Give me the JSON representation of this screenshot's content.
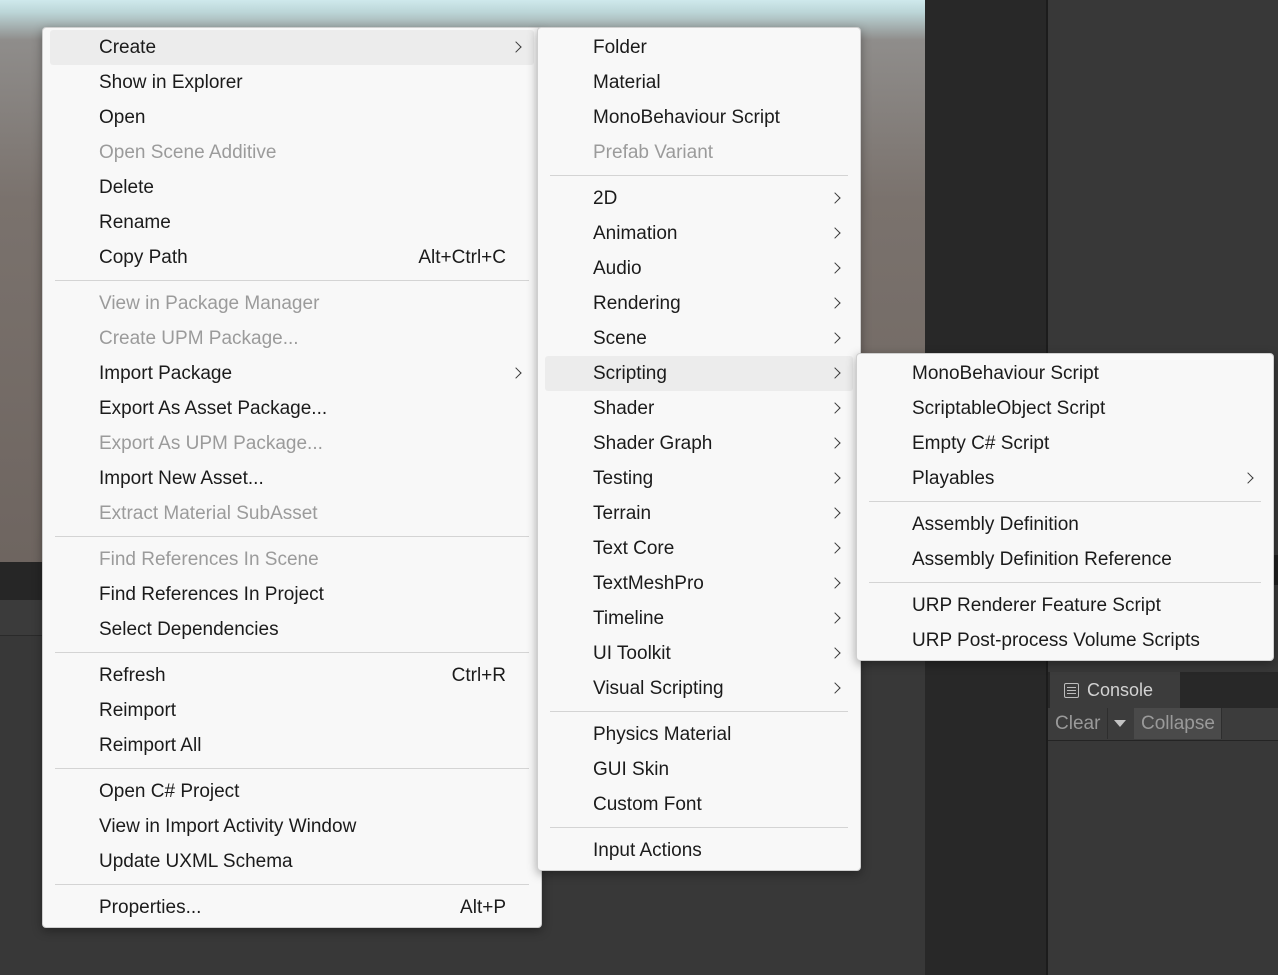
{
  "menus": {
    "main": {
      "groups": [
        [
          {
            "label": "Create",
            "shortcut": "",
            "submenu": true,
            "disabled": false,
            "highlighted": true
          },
          {
            "label": "Show in Explorer",
            "shortcut": "",
            "submenu": false,
            "disabled": false
          },
          {
            "label": "Open",
            "shortcut": "",
            "submenu": false,
            "disabled": false
          },
          {
            "label": "Open Scene Additive",
            "shortcut": "",
            "submenu": false,
            "disabled": true
          },
          {
            "label": "Delete",
            "shortcut": "",
            "submenu": false,
            "disabled": false
          },
          {
            "label": "Rename",
            "shortcut": "",
            "submenu": false,
            "disabled": false
          },
          {
            "label": "Copy Path",
            "shortcut": "Alt+Ctrl+C",
            "submenu": false,
            "disabled": false
          }
        ],
        [
          {
            "label": "View in Package Manager",
            "shortcut": "",
            "submenu": false,
            "disabled": true
          },
          {
            "label": "Create UPM Package...",
            "shortcut": "",
            "submenu": false,
            "disabled": true
          },
          {
            "label": "Import Package",
            "shortcut": "",
            "submenu": true,
            "disabled": false
          },
          {
            "label": "Export As Asset Package...",
            "shortcut": "",
            "submenu": false,
            "disabled": false
          },
          {
            "label": "Export As UPM Package...",
            "shortcut": "",
            "submenu": false,
            "disabled": true
          },
          {
            "label": "Import New Asset...",
            "shortcut": "",
            "submenu": false,
            "disabled": false
          },
          {
            "label": "Extract Material SubAsset",
            "shortcut": "",
            "submenu": false,
            "disabled": true
          }
        ],
        [
          {
            "label": "Find References In Scene",
            "shortcut": "",
            "submenu": false,
            "disabled": true
          },
          {
            "label": "Find References In Project",
            "shortcut": "",
            "submenu": false,
            "disabled": false
          },
          {
            "label": "Select Dependencies",
            "shortcut": "",
            "submenu": false,
            "disabled": false
          }
        ],
        [
          {
            "label": "Refresh",
            "shortcut": "Ctrl+R",
            "submenu": false,
            "disabled": false
          },
          {
            "label": "Reimport",
            "shortcut": "",
            "submenu": false,
            "disabled": false
          },
          {
            "label": "Reimport All",
            "shortcut": "",
            "submenu": false,
            "disabled": false
          }
        ],
        [
          {
            "label": "Open C# Project",
            "shortcut": "",
            "submenu": false,
            "disabled": false
          },
          {
            "label": "View in Import Activity Window",
            "shortcut": "",
            "submenu": false,
            "disabled": false
          },
          {
            "label": "Update UXML Schema",
            "shortcut": "",
            "submenu": false,
            "disabled": false
          }
        ],
        [
          {
            "label": "Properties...",
            "shortcut": "Alt+P",
            "submenu": false,
            "disabled": false
          }
        ]
      ]
    },
    "create": {
      "groups": [
        [
          {
            "label": "Folder",
            "submenu": false,
            "disabled": false
          },
          {
            "label": "Material",
            "submenu": false,
            "disabled": false
          },
          {
            "label": "MonoBehaviour Script",
            "submenu": false,
            "disabled": false
          },
          {
            "label": "Prefab Variant",
            "submenu": false,
            "disabled": true
          }
        ],
        [
          {
            "label": "2D",
            "submenu": true,
            "disabled": false
          },
          {
            "label": "Animation",
            "submenu": true,
            "disabled": false
          },
          {
            "label": "Audio",
            "submenu": true,
            "disabled": false
          },
          {
            "label": "Rendering",
            "submenu": true,
            "disabled": false
          },
          {
            "label": "Scene",
            "submenu": true,
            "disabled": false
          },
          {
            "label": "Scripting",
            "submenu": true,
            "disabled": false,
            "highlighted": true
          },
          {
            "label": "Shader",
            "submenu": true,
            "disabled": false
          },
          {
            "label": "Shader Graph",
            "submenu": true,
            "disabled": false
          },
          {
            "label": "Testing",
            "submenu": true,
            "disabled": false
          },
          {
            "label": "Terrain",
            "submenu": true,
            "disabled": false
          },
          {
            "label": "Text Core",
            "submenu": true,
            "disabled": false
          },
          {
            "label": "TextMeshPro",
            "submenu": true,
            "disabled": false
          },
          {
            "label": "Timeline",
            "submenu": true,
            "disabled": false
          },
          {
            "label": "UI Toolkit",
            "submenu": true,
            "disabled": false
          },
          {
            "label": "Visual Scripting",
            "submenu": true,
            "disabled": false
          }
        ],
        [
          {
            "label": "Physics Material",
            "submenu": false,
            "disabled": false
          },
          {
            "label": "GUI Skin",
            "submenu": false,
            "disabled": false
          },
          {
            "label": "Custom Font",
            "submenu": false,
            "disabled": false
          }
        ],
        [
          {
            "label": "Input Actions",
            "submenu": false,
            "disabled": false
          }
        ]
      ]
    },
    "scripting": {
      "groups": [
        [
          {
            "label": "MonoBehaviour Script",
            "submenu": false,
            "disabled": false
          },
          {
            "label": "ScriptableObject Script",
            "submenu": false,
            "disabled": false
          },
          {
            "label": "Empty C# Script",
            "submenu": false,
            "disabled": false
          },
          {
            "label": "Playables",
            "submenu": true,
            "disabled": false
          }
        ],
        [
          {
            "label": "Assembly Definition",
            "submenu": false,
            "disabled": false
          },
          {
            "label": "Assembly Definition Reference",
            "submenu": false,
            "disabled": false
          }
        ],
        [
          {
            "label": "URP Renderer Feature Script",
            "submenu": false,
            "disabled": false
          },
          {
            "label": "URP Post-process Volume Scripts",
            "submenu": false,
            "disabled": false
          }
        ]
      ]
    }
  },
  "console": {
    "tab_label": "Console",
    "tab_icon": "console-list-icon",
    "clear_label": "Clear",
    "collapse_label": "Collapse"
  }
}
